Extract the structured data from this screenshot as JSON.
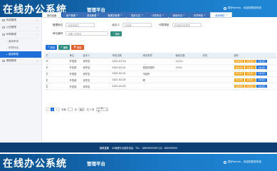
{
  "header": {
    "logo": "在线办公系统",
    "subtitle": "管理平台",
    "user": "您好admin，欢迎您登录系统"
  },
  "sidebar": {
    "items": [
      {
        "label": "系统管理",
        "arrow": "+"
      },
      {
        "label": "公告管理",
        "arrow": "+"
      },
      {
        "label": "印章管理",
        "arrow": "−"
      }
    ],
    "subitems": [
      {
        "label": "使用申请"
      },
      {
        "label": "印章外出"
      },
      {
        "label": "使用审核"
      }
    ],
    "items_after": [
      {
        "label": "请假管理",
        "arrow": "+"
      }
    ]
  },
  "tabs": [
    {
      "label": "我的桌面"
    },
    {
      "label": "用户管理"
    },
    {
      "label": "角色管理"
    },
    {
      "label": "管理员管理"
    },
    {
      "label": "登录日志"
    },
    {
      "label": "印章申请"
    },
    {
      "label": "使用申请"
    },
    {
      "label": "印章审核"
    },
    {
      "label": "使用审核"
    }
  ],
  "search": {
    "l1": "管理单位",
    "p1": "请选择单位",
    "l2": "经手人",
    "p2": "请选择",
    "l3": "印章类型",
    "p3": "请选择印章类型",
    "l4": "单位编号",
    "p4": "请输入关键字",
    "btn": "搜索"
  },
  "toolbar": {
    "add": "新增",
    "edit": "编辑",
    "del": "删除"
  },
  "table": {
    "headers": [
      "",
      "单位",
      "经手人",
      "申请日期",
      "申请事项",
      "使用次数",
      "状态",
      "操作"
    ],
    "rows": [
      [
        "开发部",
        "张学友",
        "2021-01-20",
        "",
        "11111",
        ""
      ],
      [
        "开发部",
        "张学友",
        "2021-02-01",
        "是如何是的",
        "1234",
        ""
      ],
      [
        "开发部",
        "张学友",
        "2021-02-01",
        "中经所",
        "",
        ""
      ],
      [
        "开发部",
        "张学友",
        "2021-02-03",
        "啊",
        "",
        ""
      ],
      [
        "开发部",
        "张学友",
        "2021-02-03",
        "",
        "",
        ""
      ]
    ],
    "ops": [
      "查看详情",
      "审核通过",
      "审核驳回"
    ]
  },
  "pager": {
    "pages": [
      "1"
    ],
    "goto": "到第",
    "unit": "页",
    "confirm": "确定",
    "total": "共 5 条",
    "per": "10 条/页"
  },
  "footer": {
    "left": "技术支持",
    "text": "OA管理平台服务电话：TEL：18899999999 QQ：889999999"
  },
  "icons": {
    "user": "user-icon",
    "search": "search-icon",
    "plus": "plus-icon",
    "edit": "edit-icon",
    "delete": "delete-icon"
  }
}
